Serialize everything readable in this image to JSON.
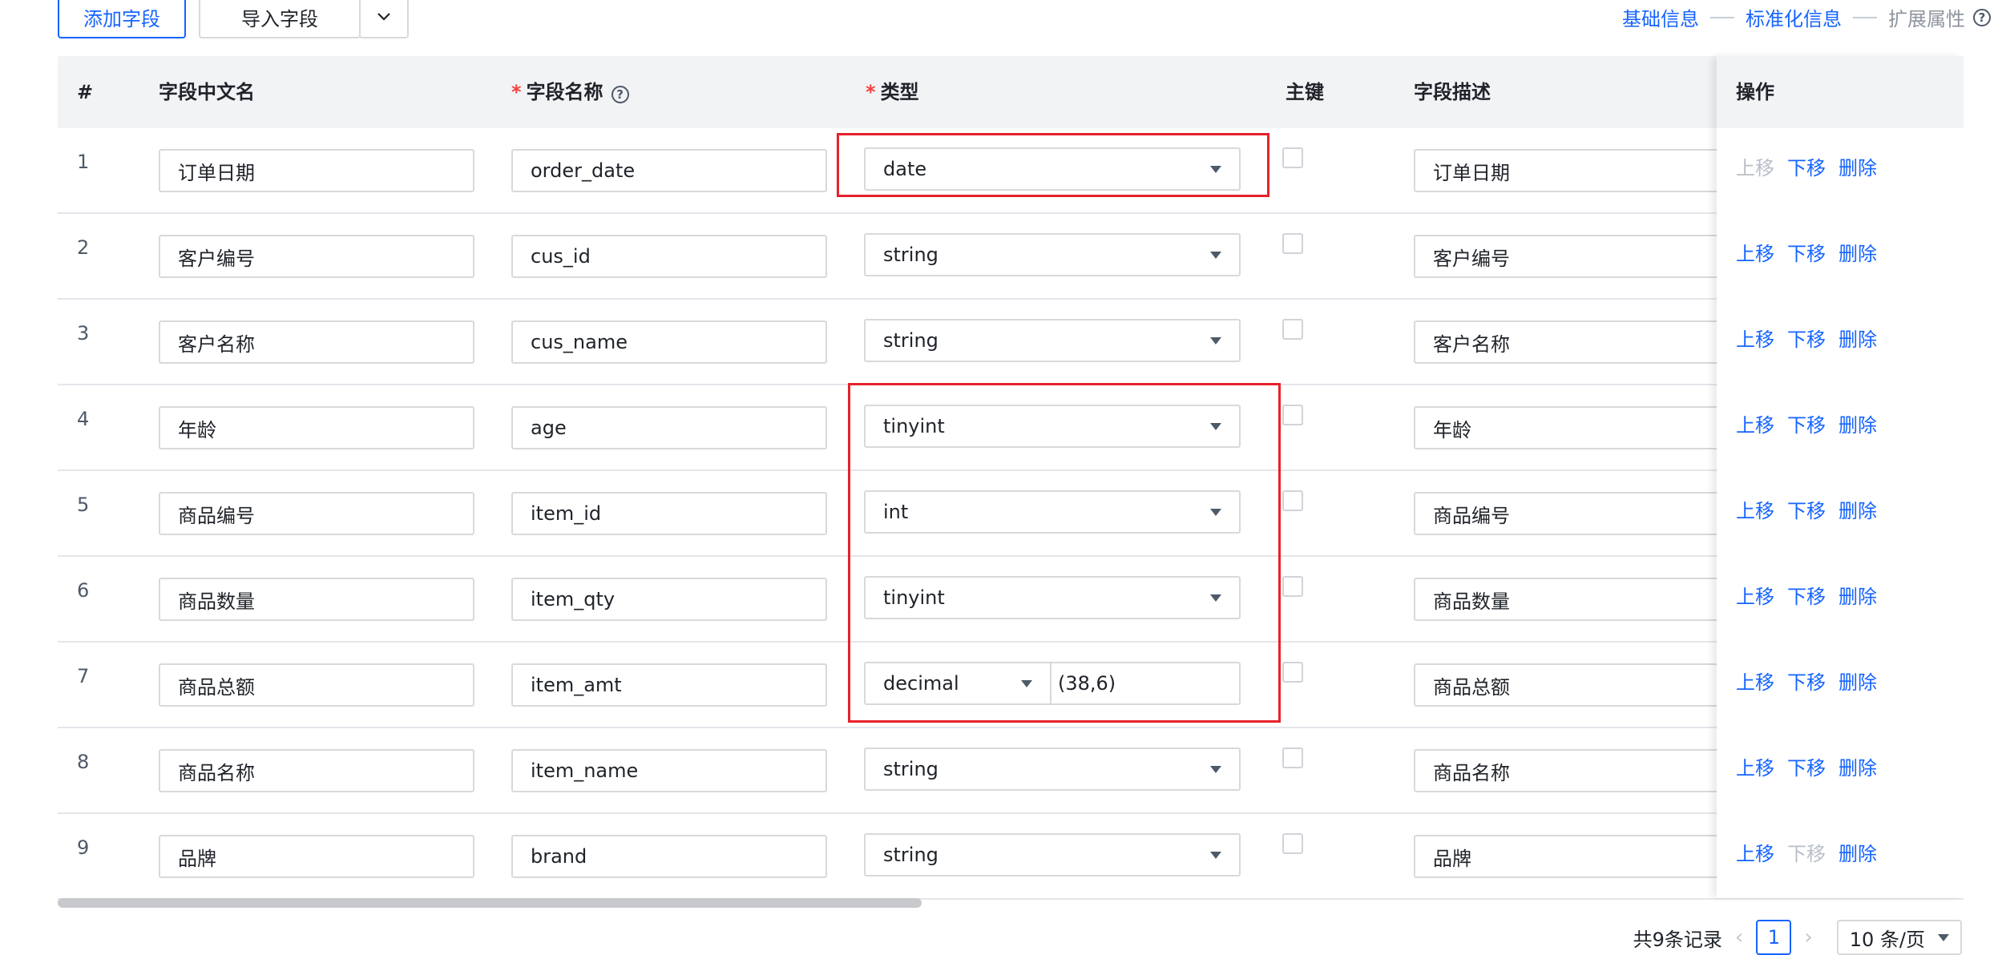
{
  "toolbar": {
    "add_label": "添加字段",
    "import_label": "导入字段"
  },
  "steps": [
    {
      "label": "基础信息",
      "state": "active"
    },
    {
      "label": "标准化信息",
      "state": "active"
    },
    {
      "label": "扩展属性",
      "state": "inactive"
    }
  ],
  "columns": {
    "index": "#",
    "cn_name": "字段中文名",
    "field_name": "字段名称",
    "type": "类型",
    "pk": "主键",
    "desc": "字段描述",
    "ops": "操作"
  },
  "required_mark": "*",
  "rows": [
    {
      "idx": "1",
      "cn": "订单日期",
      "name": "order_date",
      "type": "date",
      "desc": "订单日期",
      "up_enabled": false,
      "down_enabled": true
    },
    {
      "idx": "2",
      "cn": "客户编号",
      "name": "cus_id",
      "type": "string",
      "desc": "客户编号",
      "up_enabled": true,
      "down_enabled": true
    },
    {
      "idx": "3",
      "cn": "客户名称",
      "name": "cus_name",
      "type": "string",
      "desc": "客户名称",
      "up_enabled": true,
      "down_enabled": true
    },
    {
      "idx": "4",
      "cn": "年龄",
      "name": "age",
      "type": "tinyint",
      "desc": "年龄",
      "up_enabled": true,
      "down_enabled": true
    },
    {
      "idx": "5",
      "cn": "商品编号",
      "name": "item_id",
      "type": "int",
      "desc": "商品编号",
      "up_enabled": true,
      "down_enabled": true
    },
    {
      "idx": "6",
      "cn": "商品数量",
      "name": "item_qty",
      "type": "tinyint",
      "desc": "商品数量",
      "up_enabled": true,
      "down_enabled": true
    },
    {
      "idx": "7",
      "cn": "商品总额",
      "name": "item_amt",
      "type": "decimal",
      "precision": "(38,6)",
      "desc": "商品总额",
      "up_enabled": true,
      "down_enabled": true
    },
    {
      "idx": "8",
      "cn": "商品名称",
      "name": "item_name",
      "type": "string",
      "desc": "商品名称",
      "up_enabled": true,
      "down_enabled": true
    },
    {
      "idx": "9",
      "cn": "品牌",
      "name": "brand",
      "type": "string",
      "desc": "品牌",
      "up_enabled": true,
      "down_enabled": false
    }
  ],
  "ops_labels": {
    "up": "上移",
    "down": "下移",
    "delete": "删除"
  },
  "pagination": {
    "total_text": "共9条记录",
    "current_page": "1",
    "page_size": "10 条/页"
  },
  "colors": {
    "accent": "#1664ff",
    "highlight": "#e6212a",
    "required": "#f53f3f"
  }
}
